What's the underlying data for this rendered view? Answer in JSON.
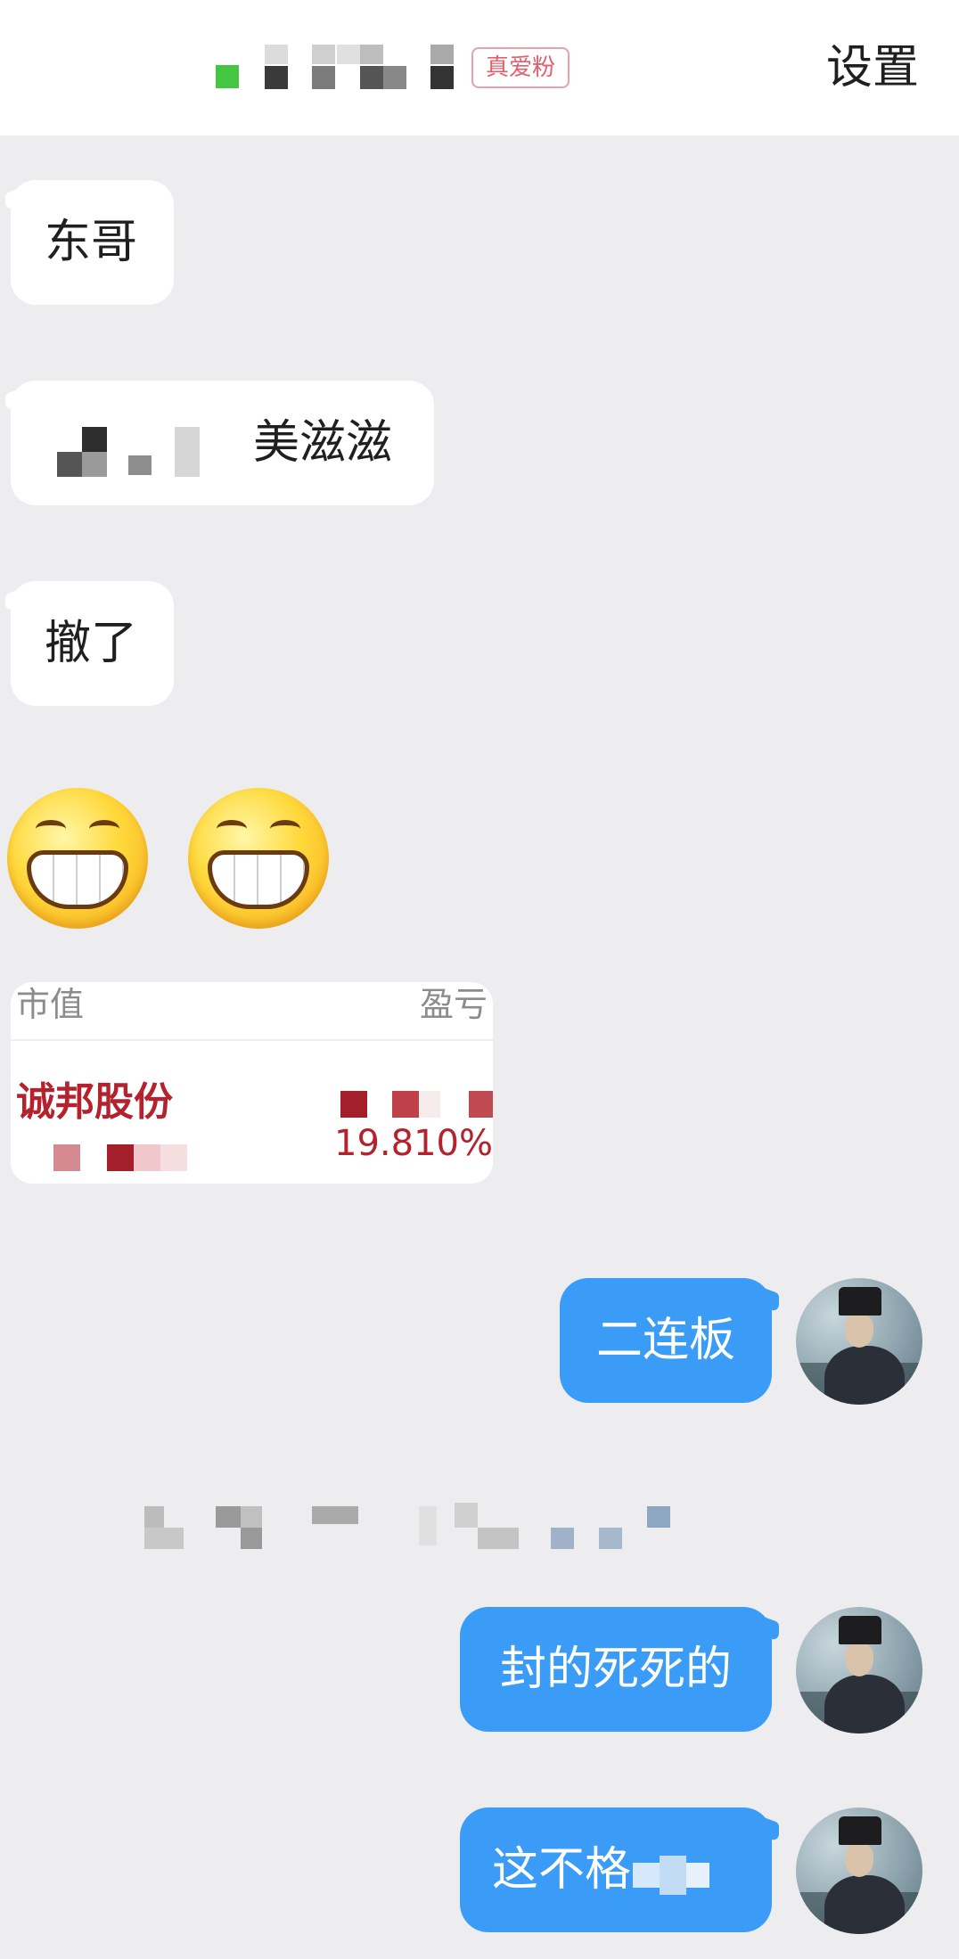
{
  "header": {
    "badge": "真爱粉",
    "settings": "设置"
  },
  "messages": {
    "m1": "东哥",
    "m2": "美滋滋",
    "m3": "撤了",
    "emoji_1": "grinning-face",
    "emoji_2": "grinning-face",
    "stock": {
      "col_left": "市值",
      "col_right": "盈亏",
      "name": "诚邦股份",
      "percent": "19.810%"
    },
    "r1": "二连板",
    "r2": "封的死死的",
    "r3": "这不格"
  },
  "colors": {
    "bubble_self": "#3b9cf7",
    "bubble_other": "#ffffff",
    "background": "#ededef",
    "badge": "#e0606c",
    "stock_red": "#b4222e"
  }
}
